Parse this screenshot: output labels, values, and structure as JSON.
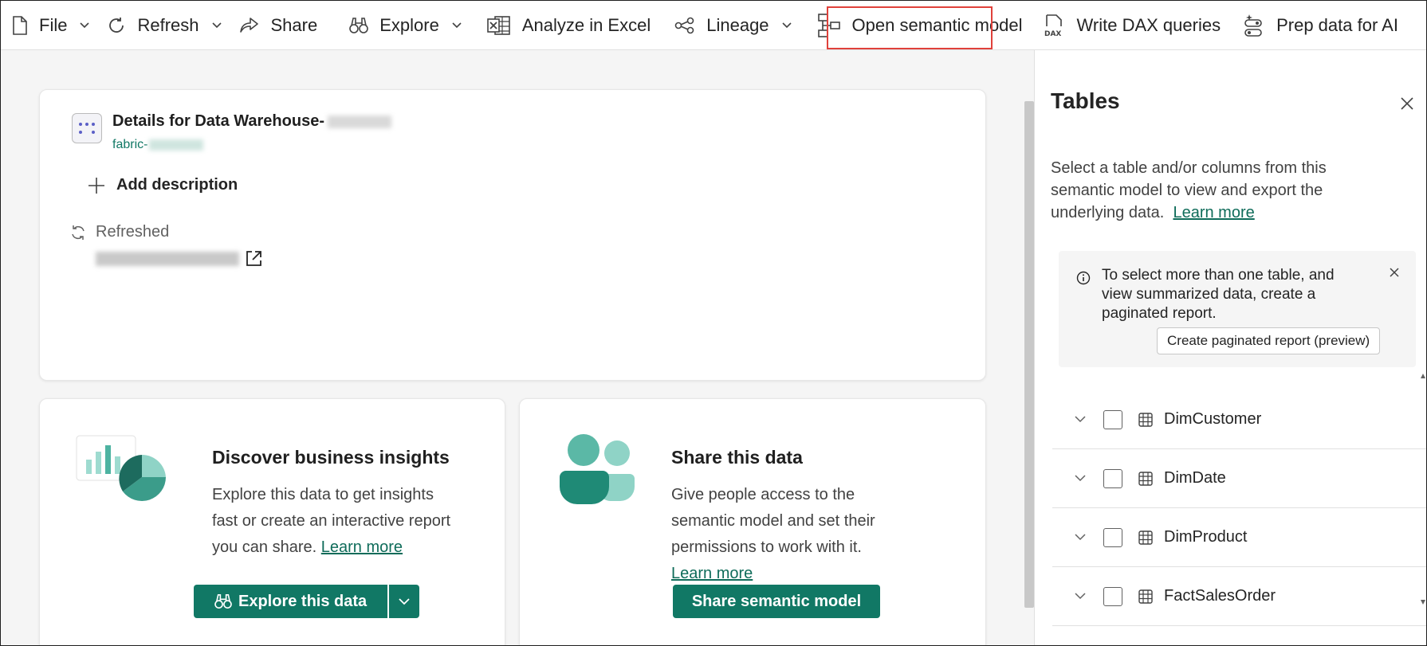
{
  "toolbar": {
    "file": "File",
    "refresh": "Refresh",
    "share": "Share",
    "explore": "Explore",
    "analyze": "Analyze in Excel",
    "lineage": "Lineage",
    "open_model": "Open semantic model",
    "write_dax": "Write DAX queries",
    "prep_ai": "Prep data for AI"
  },
  "details": {
    "title": "Details for Data Warehouse-",
    "workspace": "fabric-",
    "add_description": "Add description",
    "refreshed_label": "Refreshed"
  },
  "insights": {
    "title": "Discover business insights",
    "body": "Explore this data to get insights fast or create an interactive report you can share.",
    "link": "Learn more",
    "button": "Explore this data"
  },
  "share": {
    "title": "Share this data",
    "body": "Give people access to the semantic model and set their permissions to work with it.",
    "link": "Learn more",
    "button": "Share semantic model"
  },
  "panel": {
    "title": "Tables",
    "description": "Select a table and/or columns from this semantic model to view and export the underlying data.",
    "learn_more": "Learn more",
    "info_text": "To select more than one table, and view summarized data, create a paginated report.",
    "info_button": "Create paginated report (preview)",
    "tables": [
      "DimCustomer",
      "DimDate",
      "DimProduct",
      "FactSalesOrder"
    ]
  },
  "colors": {
    "accent": "#117865",
    "highlight": "#e0413b"
  }
}
